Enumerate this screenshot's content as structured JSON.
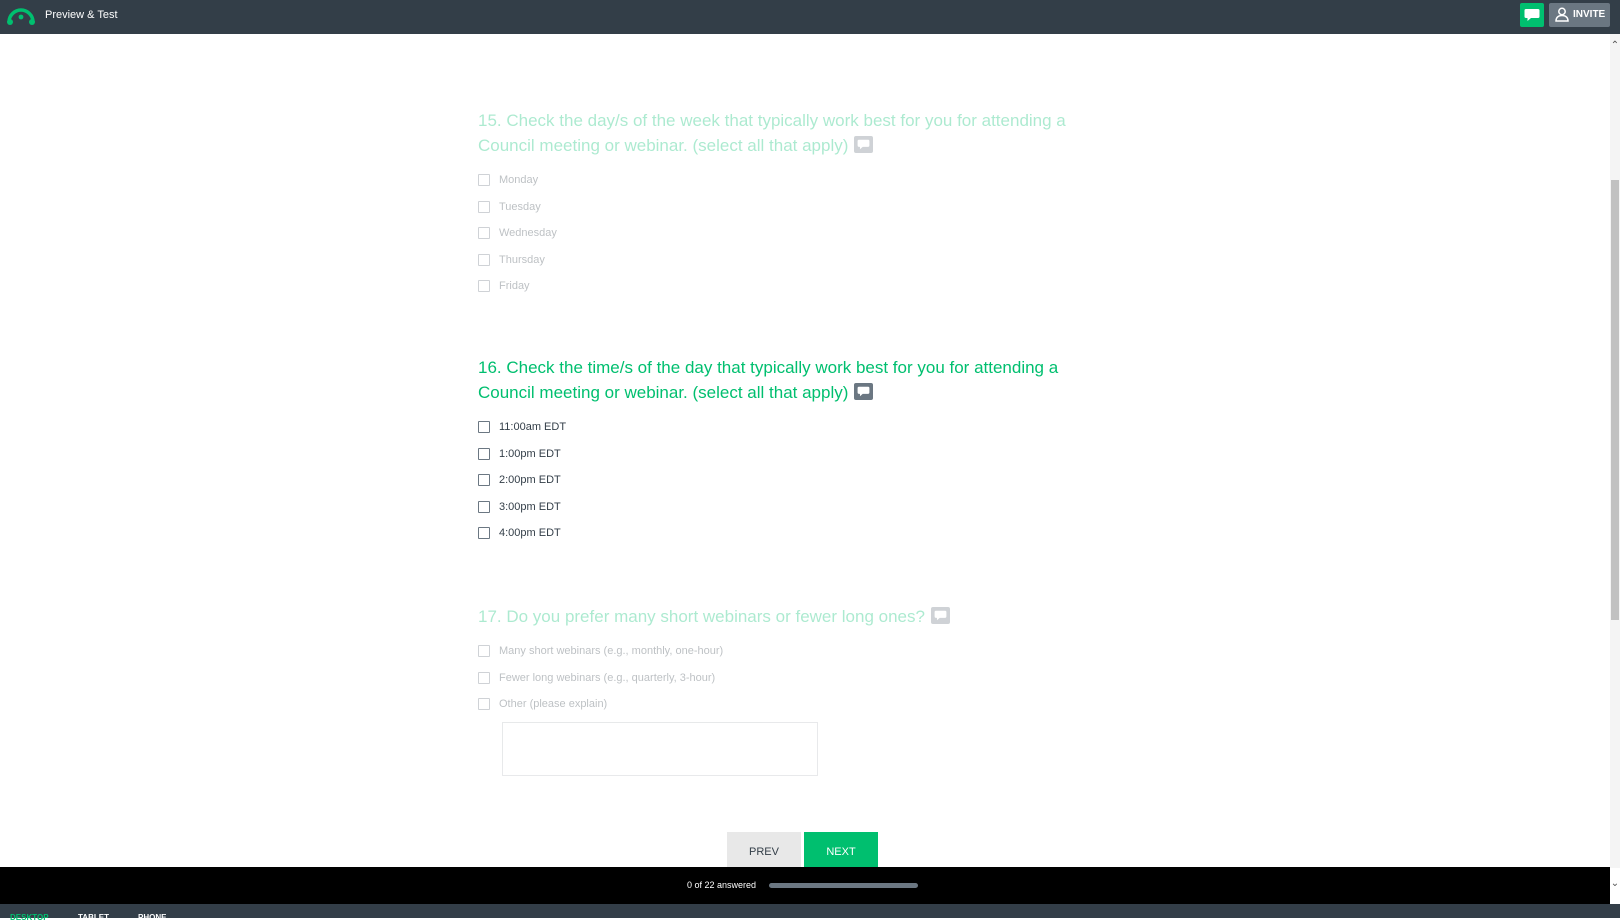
{
  "header": {
    "title": "Preview & Test",
    "invite_label": "INVITE",
    "logo_icon": "surveymonkey-logo-icon",
    "feedback_icon": "speech-bubble-icon"
  },
  "colors": {
    "accent": "#00bf6f",
    "header_bg": "#333e48",
    "footer_bg": "#000000"
  },
  "questions": [
    {
      "title": "15. Check the day/s of the week that typically work best for you for attending a Council meeting or webinar. (select all that apply)",
      "options": [
        "Monday",
        "Tuesday",
        "Wednesday",
        "Thursday",
        "Friday"
      ]
    },
    {
      "title": "16. Check the time/s of the day that typically work best for you for attending a Council meeting or webinar. (select all that apply)",
      "options": [
        "11:00am EDT",
        "1:00pm EDT",
        "2:00pm EDT",
        "3:00pm EDT",
        "4:00pm EDT"
      ]
    },
    {
      "title": "17. Do you prefer many short webinars or fewer long ones?",
      "options": [
        "Many short webinars (e.g., monthly, one-hour)",
        "Fewer long webinars (e.g., quarterly, 3-hour)",
        "Other (please explain)"
      ],
      "other_text_value": ""
    }
  ],
  "nav": {
    "prev_label": "PREV",
    "next_label": "NEXT"
  },
  "progress": {
    "text": "0 of 22 answered",
    "fraction": 0
  },
  "view_tabs": [
    "DESKTOP",
    "TABLET",
    "PHONE"
  ]
}
